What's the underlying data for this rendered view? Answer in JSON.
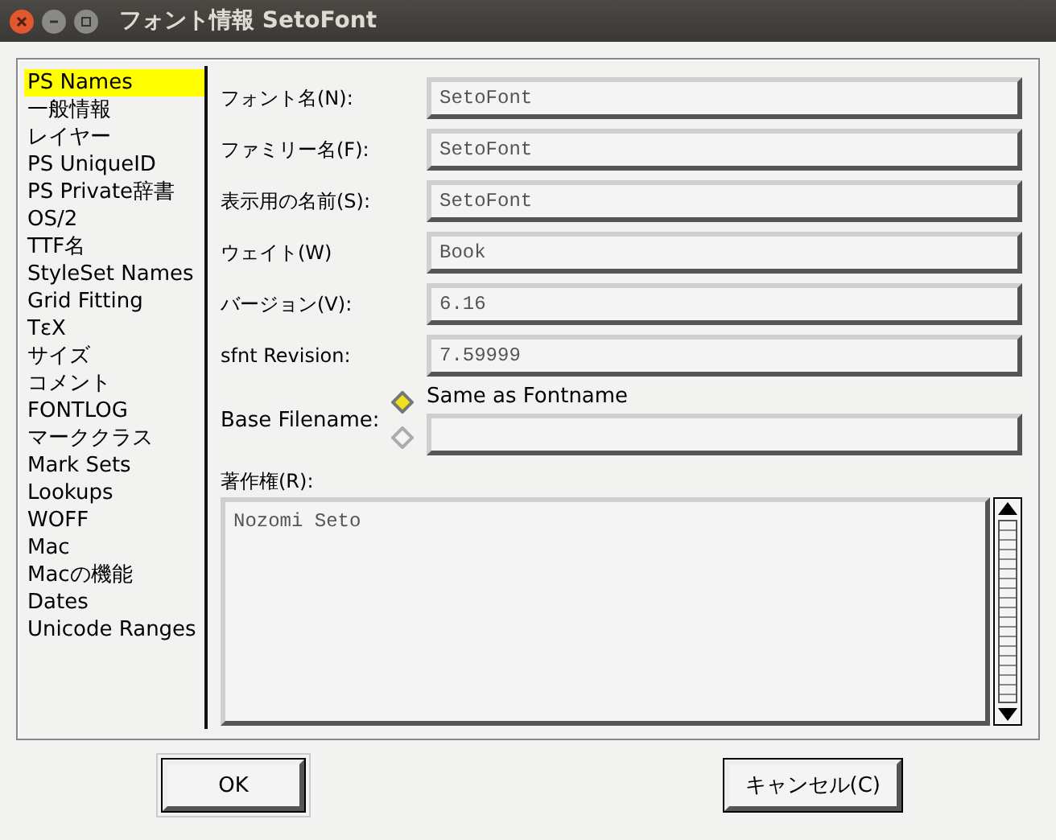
{
  "window": {
    "title": "フォント情報 SetoFont"
  },
  "sidebar": {
    "items": [
      {
        "label": "PS Names",
        "selected": true
      },
      {
        "label": "一般情報",
        "selected": false
      },
      {
        "label": "レイヤー",
        "selected": false
      },
      {
        "label": "PS UniqueID",
        "selected": false
      },
      {
        "label": "PS Private辞書",
        "selected": false
      },
      {
        "label": "OS/2",
        "selected": false
      },
      {
        "label": "TTF名",
        "selected": false
      },
      {
        "label": "StyleSet Names",
        "selected": false
      },
      {
        "label": "Grid Fitting",
        "selected": false
      },
      {
        "label": "TεX",
        "selected": false
      },
      {
        "label": "サイズ",
        "selected": false
      },
      {
        "label": "コメント",
        "selected": false
      },
      {
        "label": "FONTLOG",
        "selected": false
      },
      {
        "label": "マーククラス",
        "selected": false
      },
      {
        "label": "Mark Sets",
        "selected": false
      },
      {
        "label": "Lookups",
        "selected": false
      },
      {
        "label": "WOFF",
        "selected": false
      },
      {
        "label": "Mac",
        "selected": false
      },
      {
        "label": "Macの機能",
        "selected": false
      },
      {
        "label": "Dates",
        "selected": false
      },
      {
        "label": "Unicode Ranges",
        "selected": false
      }
    ]
  },
  "fields": [
    {
      "label": "フォント名(N):",
      "value": "SetoFont"
    },
    {
      "label": "ファミリー名(F):",
      "value": "SetoFont"
    },
    {
      "label": "表示用の名前(S):",
      "value": "SetoFont"
    },
    {
      "label": "ウェイト(W)",
      "value": "Book"
    },
    {
      "label": "バージョン(V):",
      "value": "6.16"
    },
    {
      "label": "sfnt Revision:",
      "value": "7.59999"
    }
  ],
  "base_filename": {
    "label": "Base Filename:",
    "options": [
      {
        "label": "Same as Fontname",
        "selected": true
      },
      {
        "kind": "field",
        "selected": false
      }
    ]
  },
  "copyright": {
    "label": "著作権(R):",
    "value": "Nozomi Seto"
  },
  "buttons": [
    {
      "label": "OK",
      "default": true
    },
    {
      "label": "キャンセル(C)",
      "default": false
    }
  ]
}
